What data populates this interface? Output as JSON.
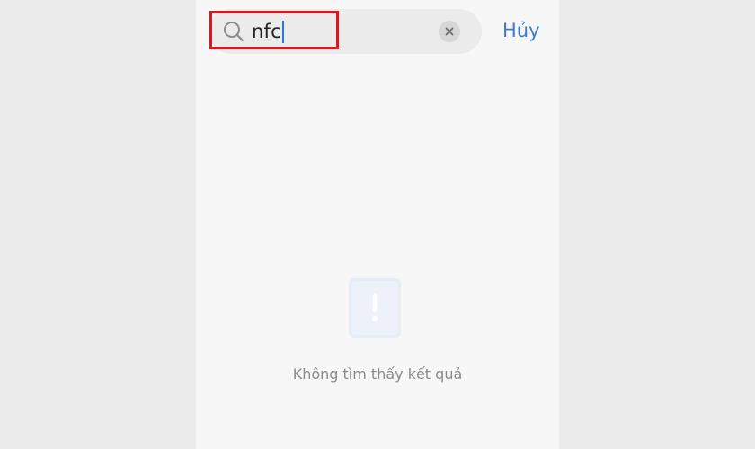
{
  "search": {
    "value": "nfc",
    "icons": {
      "search": "search-icon",
      "clear": "close-icon"
    }
  },
  "header": {
    "cancel_label": "Hủy"
  },
  "empty_state": {
    "message": "Không tìm thấy kết quả",
    "icon": "exclamation-icon"
  },
  "colors": {
    "accent": "#3a7bd0",
    "highlight": "#e2151b",
    "caret": "#2f6fe0"
  }
}
